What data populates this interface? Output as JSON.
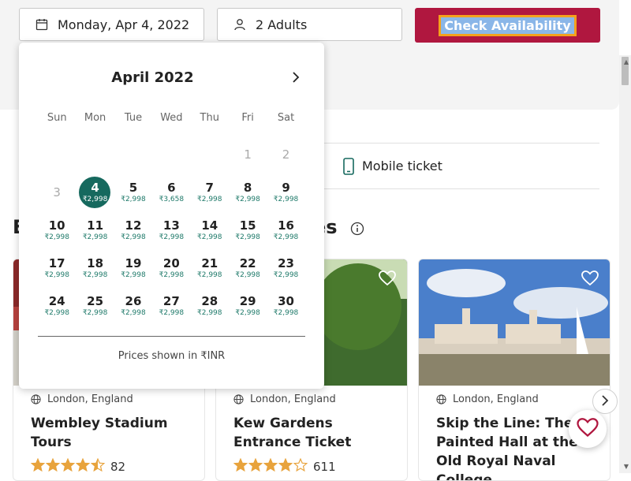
{
  "search": {
    "date_value": "Monday, Apr 4, 2022",
    "guests_value": "2 Adults",
    "cta_label": "Check Availability"
  },
  "features": {
    "mobile_ticket": "Mobile ticket"
  },
  "section": {
    "title_start": "E",
    "title_end": "es"
  },
  "cards": [
    {
      "location": "London, England",
      "title": "Wembley Stadium Tours",
      "rating": 4.5,
      "review_count": "82"
    },
    {
      "location": "London, England",
      "title": "Kew Gardens Entrance Ticket",
      "rating": 4,
      "review_count": "611"
    },
    {
      "location": "London, England",
      "title": "Skip the Line: The Painted Hall at the Old Royal Naval College",
      "rating": 0,
      "review_count": ""
    }
  ],
  "calendar": {
    "month_label": "April 2022",
    "weekdays": [
      "Sun",
      "Mon",
      "Tue",
      "Wed",
      "Thu",
      "Fri",
      "Sat"
    ],
    "days": [
      {
        "d": "1",
        "p": "",
        "state": "disabled"
      },
      {
        "d": "2",
        "p": "",
        "state": "disabled"
      },
      {
        "d": "3",
        "p": "",
        "state": "disabled"
      },
      {
        "d": "4",
        "p": "₹2,998",
        "state": "selected"
      },
      {
        "d": "5",
        "p": "₹2,998",
        "state": ""
      },
      {
        "d": "6",
        "p": "₹3,658",
        "state": ""
      },
      {
        "d": "7",
        "p": "₹2,998",
        "state": ""
      },
      {
        "d": "8",
        "p": "₹2,998",
        "state": ""
      },
      {
        "d": "9",
        "p": "₹2,998",
        "state": ""
      },
      {
        "d": "10",
        "p": "₹2,998",
        "state": ""
      },
      {
        "d": "11",
        "p": "₹2,998",
        "state": ""
      },
      {
        "d": "12",
        "p": "₹2,998",
        "state": ""
      },
      {
        "d": "13",
        "p": "₹2,998",
        "state": ""
      },
      {
        "d": "14",
        "p": "₹2,998",
        "state": ""
      },
      {
        "d": "15",
        "p": "₹2,998",
        "state": ""
      },
      {
        "d": "16",
        "p": "₹2,998",
        "state": ""
      },
      {
        "d": "17",
        "p": "₹2,998",
        "state": ""
      },
      {
        "d": "18",
        "p": "₹2,998",
        "state": ""
      },
      {
        "d": "19",
        "p": "₹2,998",
        "state": ""
      },
      {
        "d": "20",
        "p": "₹2,998",
        "state": ""
      },
      {
        "d": "21",
        "p": "₹2,998",
        "state": ""
      },
      {
        "d": "22",
        "p": "₹2,998",
        "state": ""
      },
      {
        "d": "23",
        "p": "₹2,998",
        "state": ""
      },
      {
        "d": "24",
        "p": "₹2,998",
        "state": ""
      },
      {
        "d": "25",
        "p": "₹2,998",
        "state": ""
      },
      {
        "d": "26",
        "p": "₹2,998",
        "state": ""
      },
      {
        "d": "27",
        "p": "₹2,998",
        "state": ""
      },
      {
        "d": "28",
        "p": "₹2,998",
        "state": ""
      },
      {
        "d": "29",
        "p": "₹2,998",
        "state": ""
      },
      {
        "d": "30",
        "p": "₹2,998",
        "state": ""
      }
    ],
    "first_weekday": 5,
    "footer": "Prices shown in ₹INR"
  },
  "colors": {
    "brand": "#b0173f",
    "selected_day": "#16695e",
    "price_text": "#1f7a6a",
    "star": "#e8a33c"
  }
}
